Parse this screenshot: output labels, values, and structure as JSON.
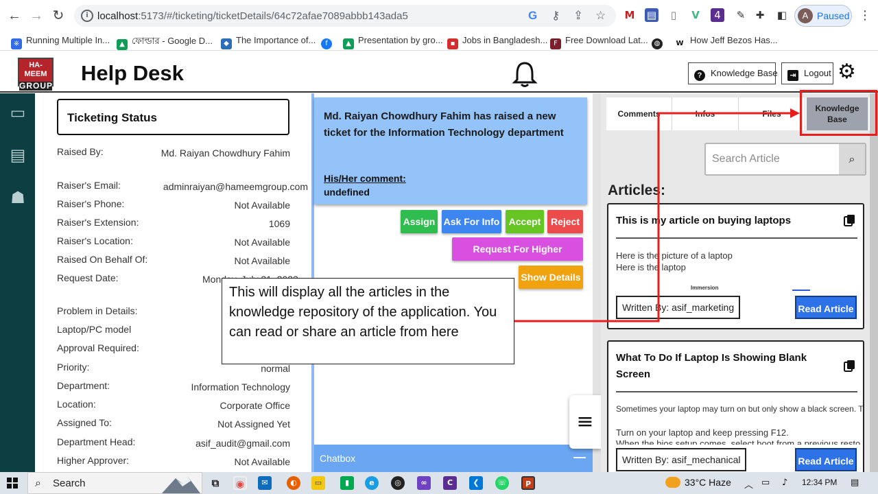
{
  "browser": {
    "url_host": "localhost",
    "url_rest": ":5173/#/ticketing/ticketDetails/64c72afae7089abbb143ada5",
    "profile_initial": "A",
    "profile_status": "Paused",
    "ext_badge": "4",
    "bookmarks": [
      "Running Multiple In...",
      "ফোল্ডার - Google D...",
      "The Importance of...",
      "",
      "Presentation by gro...",
      "Jobs in Bangladesh...",
      "Free Download Lat...",
      "",
      "How Jeff Bezos Has..."
    ]
  },
  "app": {
    "logo_top": "HA-MEEM",
    "logo_bottom": "GROUP",
    "title": "Help Desk",
    "knowledge_base_btn": "Knowledge Base",
    "logout_btn": "Logout"
  },
  "ticket": {
    "status_title": "Ticketing Status",
    "fields": [
      {
        "k": "Raised By:",
        "v": "Md. Raiyan Chowdhury Fahim"
      },
      {
        "k": "Raiser's Email:",
        "v": "adminraiyan@hameemgroup.com"
      },
      {
        "k": "Raiser's Phone:",
        "v": "Not Available"
      },
      {
        "k": "Raiser's Extension:",
        "v": "1069"
      },
      {
        "k": "Raiser's Location:",
        "v": "Not Available"
      },
      {
        "k": "Raised On Behalf Of:",
        "v": "Not Available"
      },
      {
        "k": "Request Date:",
        "v": "Monday, July 31, 2023"
      },
      {
        "k": "Problem in Details:",
        "v": ""
      },
      {
        "k": "Laptop/PC model",
        "v": ""
      },
      {
        "k": "Approval Required:",
        "v": ""
      },
      {
        "k": "Priority:",
        "v": "normal"
      },
      {
        "k": "Department:",
        "v": "Information Technology"
      },
      {
        "k": "Location:",
        "v": "Corporate Office"
      },
      {
        "k": "Assigned To:",
        "v": "Not Assigned Yet"
      },
      {
        "k": "Department Head:",
        "v": "asif_audit@gmail.com"
      },
      {
        "k": "Higher Approver:",
        "v": "Not Available"
      }
    ],
    "headline": "Md. Raiyan Chowdhury Fahim has raised a new ticket for the Information Technology department",
    "comment_label": "His/Her comment:",
    "comment_value": "undefined",
    "actions": {
      "assign": "Assign",
      "ask_info": "Ask For Info",
      "accept": "Accept",
      "reject": "Reject",
      "higher_approval": "Request For Higher Approval",
      "show_details": "Show Details"
    },
    "chatbox": "Chatbox",
    "chatbox_toggle": "—"
  },
  "right": {
    "tabs": [
      "Comments",
      "Infos",
      "Files",
      "Knowledge Base"
    ],
    "search_placeholder": "Search Article",
    "articles_heading": "Articles:",
    "articles": [
      {
        "title": "This is my article on buying laptops",
        "body1": "Here is the picture of a laptop",
        "body2": "Here is the laptop",
        "image_caption": "Immersion",
        "author": "Written By: asif_marketing",
        "read": "Read Article"
      },
      {
        "title": "What To Do If Laptop Is Showing Blank Screen",
        "body1": "Sometimes your laptop may turn on but only show a black screen. This",
        "body2": "Turn on your laptop and keep pressing F12.",
        "body3": "When the bios setup comes, select boot from a previous resto",
        "author": "Written By: asif_mechanical",
        "read": "Read Article"
      }
    ]
  },
  "annotation": {
    "text": "This will display all the articles in the knowledge repository of the application. You can read or share an article from here",
    "color": "#e61e1e"
  },
  "taskbar": {
    "search": "Search",
    "weather": "33°C  Haze",
    "time": "12:34 PM"
  }
}
